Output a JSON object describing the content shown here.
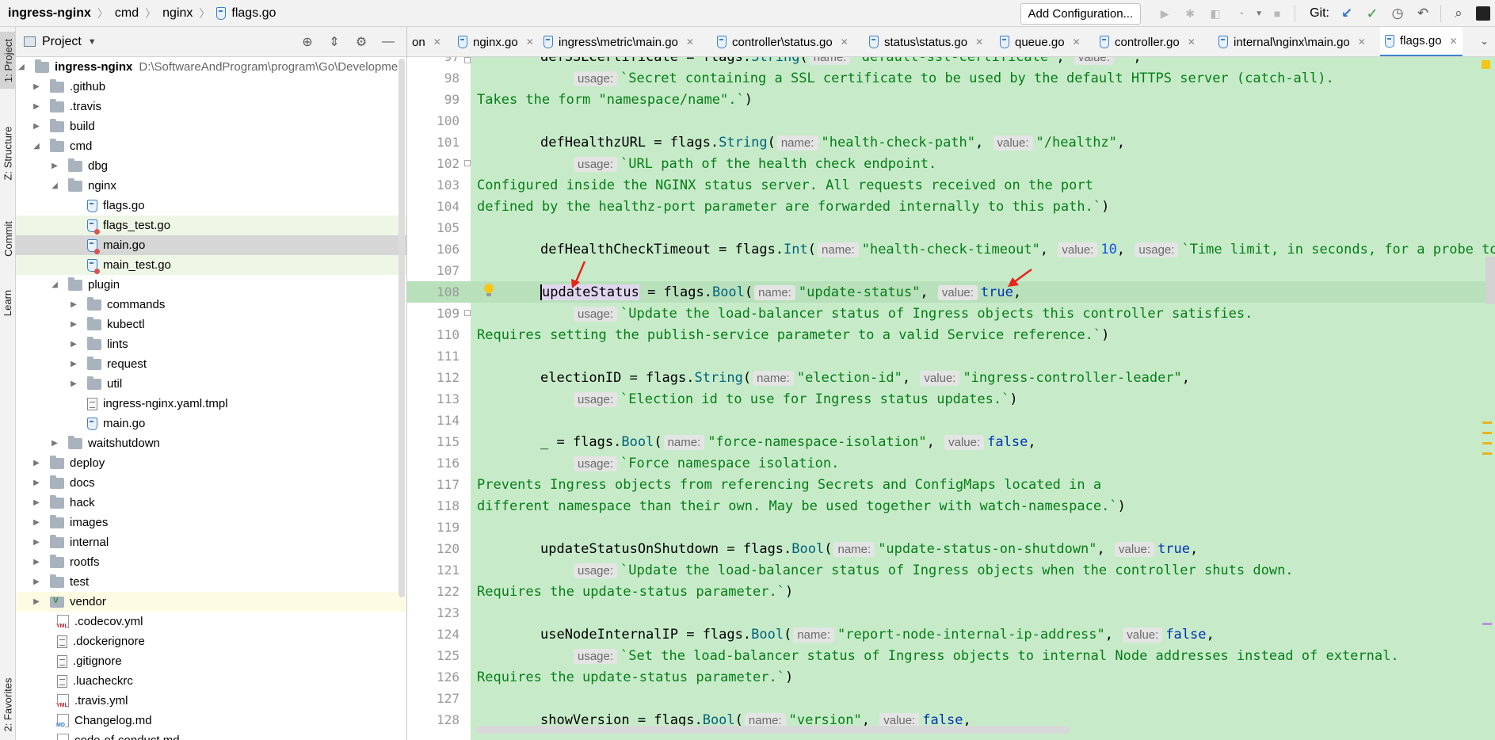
{
  "breadcrumb": {
    "project": "ingress-nginx",
    "parts": [
      "cmd",
      "nginx"
    ],
    "file": "flags.go"
  },
  "toolbar": {
    "add_config_label": "Add Configuration...",
    "git_label": "Git:"
  },
  "left_stripe": {
    "tabs": [
      "1: Project",
      "Z: Structure",
      "Commit",
      "Learn",
      "2: Favorites"
    ]
  },
  "project_panel": {
    "title": "Project",
    "root_name": "ingress-nginx",
    "root_path": "D:\\SoftwareAndProgram\\program\\Go\\Developme",
    "items": [
      {
        "label": ".github",
        "type": "folder"
      },
      {
        "label": ".travis",
        "type": "folder"
      },
      {
        "label": "build",
        "type": "folder"
      },
      {
        "label": "cmd",
        "type": "folder"
      },
      {
        "label": "dbg",
        "type": "folder"
      },
      {
        "label": "nginx",
        "type": "folder"
      },
      {
        "label": "flags.go",
        "type": "go"
      },
      {
        "label": "flags_test.go",
        "type": "go-test"
      },
      {
        "label": "main.go",
        "type": "go"
      },
      {
        "label": "main_test.go",
        "type": "go-test"
      },
      {
        "label": "plugin",
        "type": "folder"
      },
      {
        "label": "commands",
        "type": "folder"
      },
      {
        "label": "kubectl",
        "type": "folder"
      },
      {
        "label": "lints",
        "type": "folder"
      },
      {
        "label": "request",
        "type": "folder"
      },
      {
        "label": "util",
        "type": "folder"
      },
      {
        "label": "ingress-nginx.yaml.tmpl",
        "type": "text"
      },
      {
        "label": "main.go",
        "type": "go"
      },
      {
        "label": "waitshutdown",
        "type": "folder"
      },
      {
        "label": "deploy",
        "type": "folder"
      },
      {
        "label": "docs",
        "type": "folder"
      },
      {
        "label": "hack",
        "type": "folder"
      },
      {
        "label": "images",
        "type": "folder"
      },
      {
        "label": "internal",
        "type": "folder"
      },
      {
        "label": "rootfs",
        "type": "folder"
      },
      {
        "label": "test",
        "type": "folder"
      },
      {
        "label": "vendor",
        "type": "vendor"
      },
      {
        "label": ".codecov.yml",
        "type": "yml"
      },
      {
        "label": ".dockerignore",
        "type": "text"
      },
      {
        "label": ".gitignore",
        "type": "text"
      },
      {
        "label": ".luacheckrc",
        "type": "text"
      },
      {
        "label": ".travis.yml",
        "type": "yml"
      },
      {
        "label": "Changelog.md",
        "type": "md"
      },
      {
        "label": "code-of-conduct.md",
        "type": "md"
      }
    ]
  },
  "editor_tabs": [
    {
      "label": "on"
    },
    {
      "label": "nginx.go"
    },
    {
      "label": "ingress\\metric\\main.go"
    },
    {
      "label": "controller\\status.go"
    },
    {
      "label": "status\\status.go"
    },
    {
      "label": "queue.go"
    },
    {
      "label": "controller.go"
    },
    {
      "label": "internal\\nginx\\main.go"
    },
    {
      "label": "flags.go"
    }
  ],
  "code": {
    "line_numbers": [
      "97",
      "98",
      "99",
      "100",
      "101",
      "102",
      "103",
      "104",
      "105",
      "106",
      "107",
      "108",
      "109",
      "110",
      "111",
      "112",
      "113",
      "114",
      "115",
      "116",
      "117",
      "118",
      "119",
      "120",
      "121",
      "122",
      "123",
      "124",
      "125",
      "126",
      "127",
      "128"
    ],
    "l97": {
      "a": "defSSLCertificate = flags.",
      "b": "String",
      "c": "(",
      "h1": "name:",
      "s1": "\"default-ssl-certificate\"",
      "d": ",",
      "h2": "value:",
      "s2": "\"\"",
      "e": ","
    },
    "l98": {
      "h": "usage:",
      "s": "`Secret containing a SSL certificate to be used by the default HTTPS server (catch-all)."
    },
    "l99": {
      "s": "Takes the form \"namespace/name\".`",
      "e": ")"
    },
    "l101": {
      "a": "defHealthzURL = flags.",
      "b": "String",
      "c": "(",
      "h1": "name:",
      "s1": "\"health-check-path\"",
      "d": ",",
      "h2": "value:",
      "s2": "\"/healthz\"",
      "e": ","
    },
    "l102": {
      "h": "usage:",
      "s": "`URL path of the health check endpoint."
    },
    "l103": {
      "s": "Configured inside the NGINX status server. All requests received on the port"
    },
    "l104": {
      "s": "defined by the healthz-port parameter are forwarded internally to this path.`",
      "e": ")"
    },
    "l106": {
      "a": "defHealthCheckTimeout = flags.",
      "b": "Int",
      "c": "(",
      "h1": "name:",
      "s1": "\"health-check-timeout\"",
      "d": ",",
      "h2": "value:",
      "n2": "10",
      "d2": ",",
      "h3": "usage:",
      "s3": "`Time limit, in seconds, for a probe to"
    },
    "l108": {
      "a": "updateStatus",
      "a2": " = flags.",
      "b": "Bool",
      "c": "(",
      "h1": "name:",
      "s1": "\"update-status\"",
      "d": ",",
      "h2": "value:",
      "k2": "true",
      "e": ","
    },
    "l109": {
      "h": "usage:",
      "s": "`Update the load-balancer status of Ingress objects this controller satisfies."
    },
    "l110": {
      "s": "Requires setting the publish-service parameter to a valid Service reference.`",
      "e": ")"
    },
    "l112": {
      "a": "electionID = flags.",
      "b": "String",
      "c": "(",
      "h1": "name:",
      "s1": "\"election-id\"",
      "d": ",",
      "h2": "value:",
      "s2": "\"ingress-controller-leader\"",
      "e": ","
    },
    "l113": {
      "h": "usage:",
      "s": "`Election id to use for Ingress status updates.`",
      "e": ")"
    },
    "l115": {
      "a": "_ = flags.",
      "b": "Bool",
      "c": "(",
      "h1": "name:",
      "s1": "\"force-namespace-isolation\"",
      "d": ",",
      "h2": "value:",
      "k2": "false",
      "e": ","
    },
    "l116": {
      "h": "usage:",
      "s": "`Force namespace isolation."
    },
    "l117": {
      "s": "Prevents Ingress objects from referencing Secrets and ConfigMaps located in a"
    },
    "l118": {
      "s": "different namespace than their own. May be used together with watch-namespace.`",
      "e": ")"
    },
    "l120": {
      "a": "updateStatusOnShutdown = flags.",
      "b": "Bool",
      "c": "(",
      "h1": "name:",
      "s1": "\"update-status-on-shutdown\"",
      "d": ",",
      "h2": "value:",
      "k2": "true",
      "e": ","
    },
    "l121": {
      "h": "usage:",
      "s": "`Update the load-balancer status of Ingress objects when the controller shuts down."
    },
    "l122": {
      "s": "Requires the update-status parameter.`",
      "e": ")"
    },
    "l124": {
      "a": "useNodeInternalIP = flags.",
      "b": "Bool",
      "c": "(",
      "h1": "name:",
      "s1": "\"report-node-internal-ip-address\"",
      "d": ",",
      "h2": "value:",
      "k2": "false",
      "e": ","
    },
    "l125": {
      "h": "usage:",
      "s": "`Set the load-balancer status of Ingress objects to internal Node addresses instead of external."
    },
    "l126": {
      "s": "Requires the update-status parameter.`",
      "e": ")"
    },
    "l128": {
      "a": "showVersion = flags.",
      "b": "Bool",
      "c": "(",
      "h1": "name:",
      "s1": "\"version\"",
      "d": ",",
      "h2": "value:",
      "k2": "false",
      "e": ","
    }
  },
  "colors": {
    "code_background": "#c7ebc9",
    "string": "#067d17",
    "keyword": "#0033b3",
    "annotation_arrow": "#e8231b"
  }
}
